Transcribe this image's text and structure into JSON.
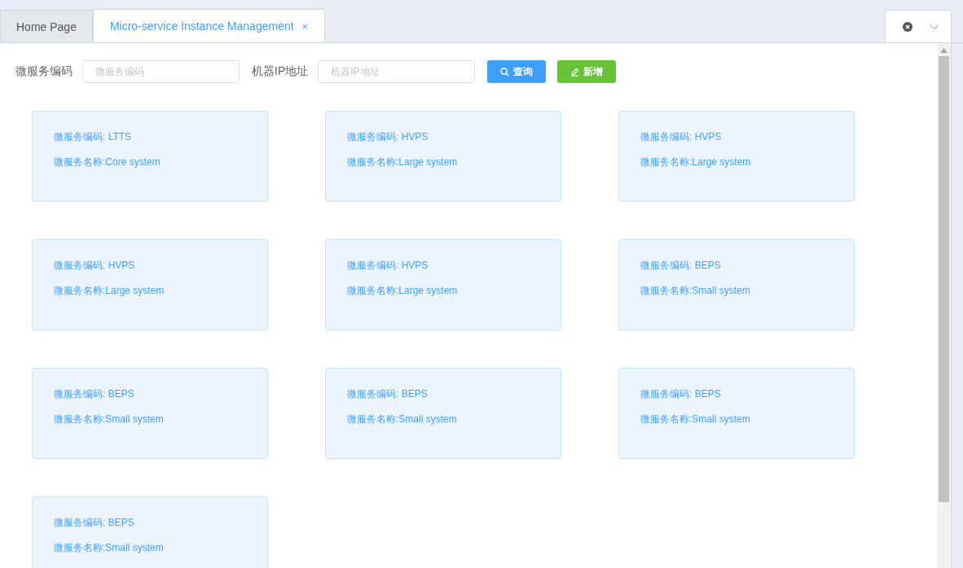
{
  "tabs": [
    {
      "label": "Home Page",
      "selected": false
    },
    {
      "label": "Micro-service Instance Management",
      "selected": true,
      "close": "×"
    }
  ],
  "search": {
    "fields": [
      {
        "label": "微服务编码",
        "placeholder": "微服务编码"
      },
      {
        "label": "机器IP地址",
        "placeholder": "机器IP地址"
      }
    ],
    "buttons": [
      {
        "label": "查询",
        "kind": "search"
      },
      {
        "label": "新增",
        "kind": "add"
      }
    ]
  },
  "cards": [
    {
      "code": "微服务编码: LTTS",
      "name": "微服务名称:Core system"
    },
    {
      "code": "微服务编码: HVPS",
      "name": "微服务名称:Large system"
    },
    {
      "code": "微服务编码: HVPS",
      "name": "微服务名称:Large system"
    },
    {
      "code": "微服务编码: HVPS",
      "name": "微服务名称:Large system"
    },
    {
      "code": "微服务编码: HVPS",
      "name": "微服务名称:Large system"
    },
    {
      "code": "微服务编码: BEPS",
      "name": "微服务名称:Small system"
    },
    {
      "code": "微服务编码: BEPS",
      "name": "微服务名称:Small system"
    },
    {
      "code": "微服务编码: BEPS",
      "name": "微服务名称:Small system"
    },
    {
      "code": "微服务编码: BEPS",
      "name": "微服务名称:Small system"
    },
    {
      "code": "微服务编码: BEPS",
      "name": "微服务名称:Small system"
    }
  ]
}
